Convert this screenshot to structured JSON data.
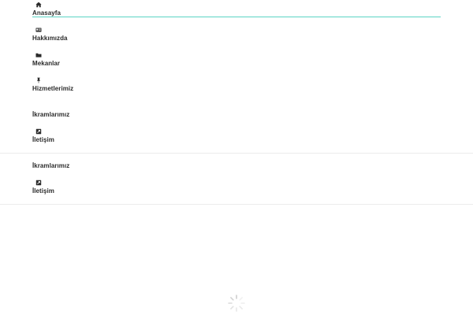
{
  "nav": {
    "items": [
      {
        "label": "Anasayfa",
        "icon": "home-icon"
      },
      {
        "label": "Hakkımızda",
        "icon": "id-card-icon"
      },
      {
        "label": "Mekanlar",
        "icon": "folder-icon"
      },
      {
        "label": "Hizmetlerimiz",
        "icon": "pin-icon"
      },
      {
        "label": "İkramlarımız",
        "icon": ""
      },
      {
        "label": "İletişim",
        "icon": "contact-icon"
      }
    ],
    "active_index": 0
  },
  "overflow_menu": {
    "items": [
      {
        "label": "İkramlarımız",
        "icon": ""
      },
      {
        "label": "İletişim",
        "icon": "contact-icon"
      }
    ]
  },
  "loader": {
    "icon": "spinner-icon"
  },
  "colors": {
    "accent": "#5bd3c4",
    "text": "#2b2b2b",
    "divider": "#ececec",
    "spinner": "#cfcfcf"
  }
}
